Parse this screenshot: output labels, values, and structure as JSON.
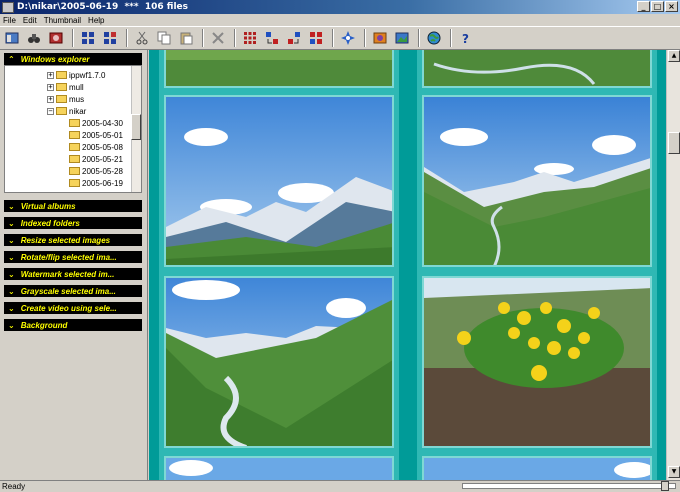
{
  "window": {
    "title": "D:\\nikar\\2005-06-19  ***  106 files",
    "controls": [
      "_",
      "□",
      "×"
    ]
  },
  "menu": [
    "File",
    "Edit",
    "Thumbnail",
    "Help"
  ],
  "toolbar": {
    "icons": [
      "explorer-icon",
      "binoculars-icon",
      "photo-icon",
      "grid-view-icon",
      "grid-view-alt-icon",
      "cut-icon",
      "copy-icon",
      "paste-icon",
      "delete-icon",
      "select-all-icon",
      "rotate-left-icon",
      "rotate-right-icon",
      "arrange-icon",
      "settings-icon",
      "slideshow-icon",
      "image-icon",
      "globe-icon",
      "help-icon"
    ]
  },
  "explorer": {
    "header": "Windows explorer",
    "tree": [
      {
        "label": "ippwf1.7.0",
        "level": 1,
        "expander": "+"
      },
      {
        "label": "mull",
        "level": 1,
        "expander": "+"
      },
      {
        "label": "mus",
        "level": 1,
        "expander": "+"
      },
      {
        "label": "nikar",
        "level": 1,
        "expander": "−"
      },
      {
        "label": "2005-04-30",
        "level": 2
      },
      {
        "label": "2005-05-01",
        "level": 2
      },
      {
        "label": "2005-05-08",
        "level": 2
      },
      {
        "label": "2005-05-21",
        "level": 2
      },
      {
        "label": "2005-05-28",
        "level": 2
      },
      {
        "label": "2005-06-19",
        "level": 2
      }
    ]
  },
  "sections": [
    "Virtual albums",
    "Indexed folders",
    "Resize selected images",
    "Rotate/flip selected ima...",
    "Watermark selected im...",
    "Grayscale selected ima...",
    "Create video using sele...",
    "Background"
  ],
  "status": {
    "text": "Ready"
  },
  "colors": {
    "gallery_bg": "#009b98",
    "header_bg": "#000000",
    "header_text": "#ffff00"
  }
}
